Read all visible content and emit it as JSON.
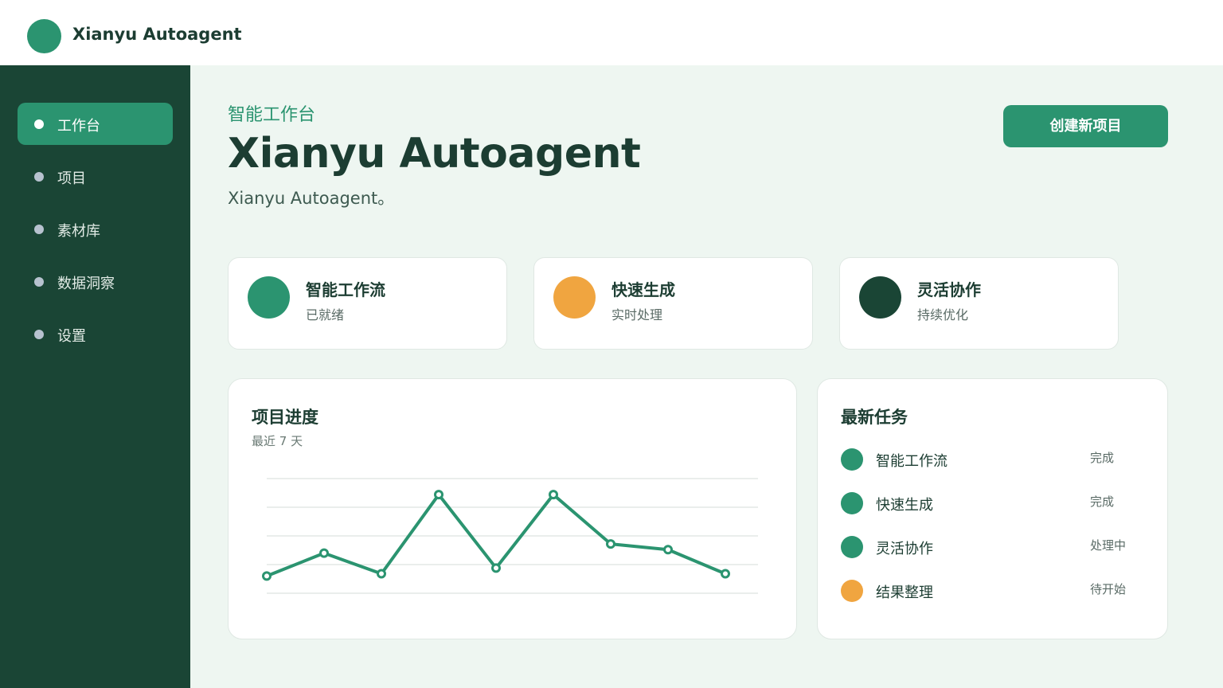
{
  "app": {
    "brand_name": "Xianyu Autoagent"
  },
  "sidebar": {
    "items": [
      {
        "label": "工作台",
        "active": true
      },
      {
        "label": "项目",
        "active": false
      },
      {
        "label": "素材库",
        "active": false
      },
      {
        "label": "数据洞察",
        "active": false
      },
      {
        "label": "设置",
        "active": false
      }
    ]
  },
  "header": {
    "subtitle": "智能工作台",
    "title": "Xianyu Autoagent",
    "description": "Xianyu Autoagent。",
    "create_button": "创建新项目"
  },
  "stats": [
    {
      "title": "智能工作流",
      "subtitle": "已就绪",
      "color": "#2b9470"
    },
    {
      "title": "快速生成",
      "subtitle": "实时处理",
      "color": "#f0a540"
    },
    {
      "title": "灵活协作",
      "subtitle": "持续优化",
      "color": "#1a4535"
    }
  ],
  "progress": {
    "title": "项目进度",
    "subtitle": "最近 7 天"
  },
  "chart_data": {
    "type": "line",
    "title": "项目进度",
    "subtitle": "最近 7 天",
    "grid": true,
    "ylim": [
      0,
      100
    ],
    "series": [
      {
        "values": [
          15,
          35,
          17,
          86,
          22,
          86,
          43,
          38,
          17
        ]
      }
    ]
  },
  "tasks": {
    "title": "最新任务",
    "items": [
      {
        "name": "智能工作流",
        "status": "完成",
        "color": "#2b9470"
      },
      {
        "name": "快速生成",
        "status": "完成",
        "color": "#2b9470"
      },
      {
        "name": "灵活协作",
        "status": "处理中",
        "color": "#2b9470"
      },
      {
        "name": "结果整理",
        "status": "待开始",
        "color": "#f0a540"
      }
    ]
  },
  "colors": {
    "primary": "#2b9470",
    "sidebar": "#1a4535",
    "accent": "#f0a540",
    "background": "#eef6f1"
  }
}
